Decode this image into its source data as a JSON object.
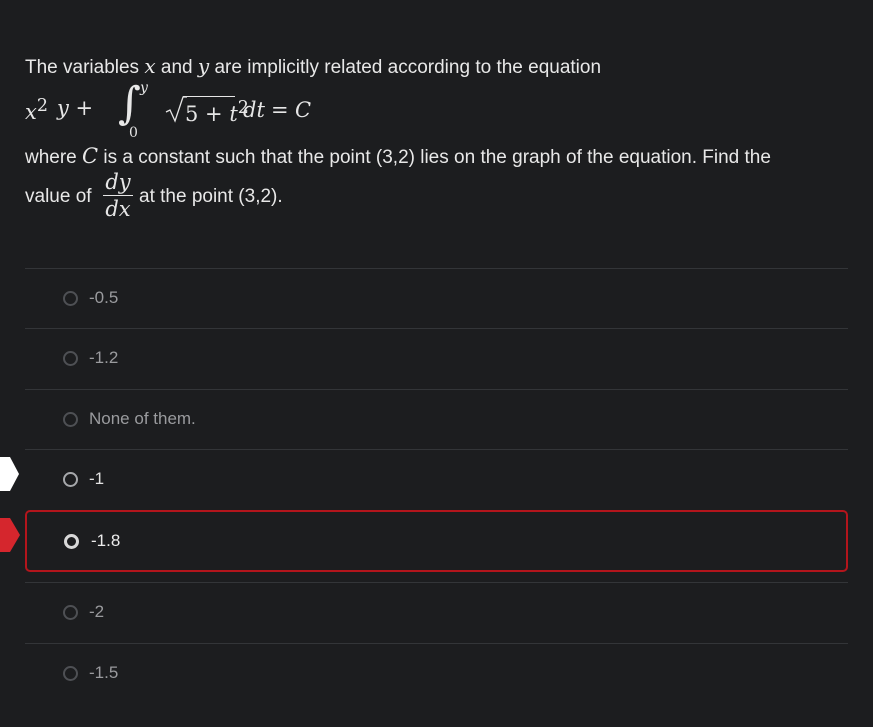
{
  "question": {
    "line1": {
      "t1": "The variables ",
      "x": "x",
      "t2": " and ",
      "y": "y",
      "t3": " are implicitly related according to the equation"
    },
    "equation": {
      "x": "x",
      "x_exp": "2",
      "y_plus": "y +",
      "upper_limit": "y",
      "lower_limit": "0",
      "radicand_a": "5 +",
      "radicand_t": "t",
      "radicand_exp": "2",
      "dt": "dt",
      "equals": "=",
      "C": "C"
    },
    "line3": {
      "t1": "where ",
      "C": "C",
      "t2": " is a constant such that the point (3,2) lies on the graph of the equation. Find the"
    },
    "line4": {
      "t1": "value of",
      "num": "dy",
      "den": "dx",
      "t2": "at the point (3,2)."
    }
  },
  "options": [
    {
      "label": "-0.5",
      "state": "default"
    },
    {
      "label": "-1.2",
      "state": "default"
    },
    {
      "label": "None of them.",
      "state": "default"
    },
    {
      "label": "-1",
      "state": "hover"
    },
    {
      "label": "-1.8",
      "state": "selected"
    },
    {
      "label": "-2",
      "state": "default"
    },
    {
      "label": "-1.5",
      "state": "default"
    }
  ],
  "colors": {
    "background": "#1c1d1f",
    "selected_border": "#b3151c",
    "wrong_marker": "#d5262d",
    "hover_marker": "#ffffff"
  }
}
